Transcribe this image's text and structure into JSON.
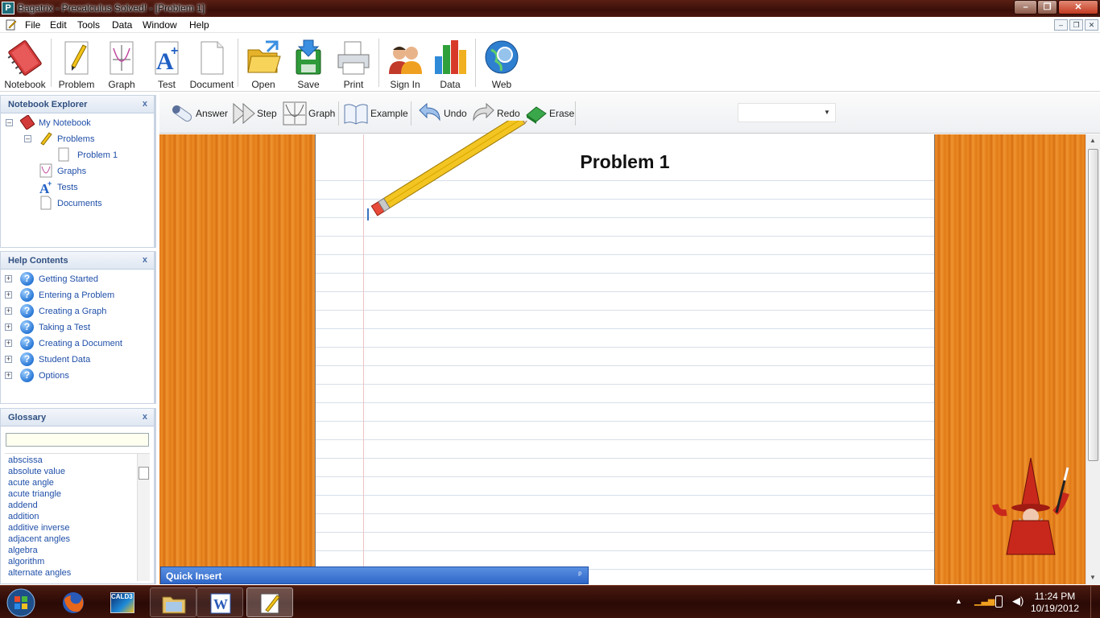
{
  "window": {
    "title": "Bagatrix - Precalculus Solved! - [Problem 1]"
  },
  "menu": {
    "items": [
      "File",
      "Edit",
      "Tools",
      "Data",
      "Window",
      "Help"
    ]
  },
  "toolbar": {
    "notebook": "Notebook",
    "problem": "Problem",
    "graph": "Graph",
    "test": "Test",
    "document": "Document",
    "open": "Open",
    "save": "Save",
    "print": "Print",
    "sign_in": "Sign In",
    "data": "Data",
    "web": "Web"
  },
  "notebook_explorer": {
    "title": "Notebook Explorer",
    "close": "x",
    "root": "My Notebook",
    "problems": "Problems",
    "problem_1": "Problem 1",
    "graphs": "Graphs",
    "tests": "Tests",
    "documents": "Documents"
  },
  "help_contents": {
    "title": "Help Contents",
    "close": "x",
    "items": [
      "Getting Started",
      "Entering a Problem",
      "Creating a Graph",
      "Taking a Test",
      "Creating a Document",
      "Student Data",
      "Options"
    ]
  },
  "glossary": {
    "title": "Glossary",
    "close": "x",
    "search_value": "",
    "items": [
      "abscissa",
      "absolute value",
      "acute angle",
      "acute triangle",
      "addend",
      "addition",
      "additive inverse",
      "adjacent angles",
      "algebra",
      "algorithm",
      "alternate angles"
    ]
  },
  "subtoolbar": {
    "answer": "Answer",
    "step": "Step",
    "graph": "Graph",
    "example": "Example",
    "undo": "Undo",
    "redo": "Redo",
    "erase": "Erase",
    "combo_value": ""
  },
  "worksheet": {
    "title": "Problem 1"
  },
  "quick_insert": {
    "label": "Quick Insert",
    "pin": "ᵖ"
  },
  "taskbar": {
    "app_label": "CALD3",
    "time": "11:24 PM",
    "date": "10/19/2012"
  },
  "colors": {
    "accent": "#2f67c9",
    "workspace_wood": "#e27e1b",
    "link": "#1f4fa8"
  }
}
